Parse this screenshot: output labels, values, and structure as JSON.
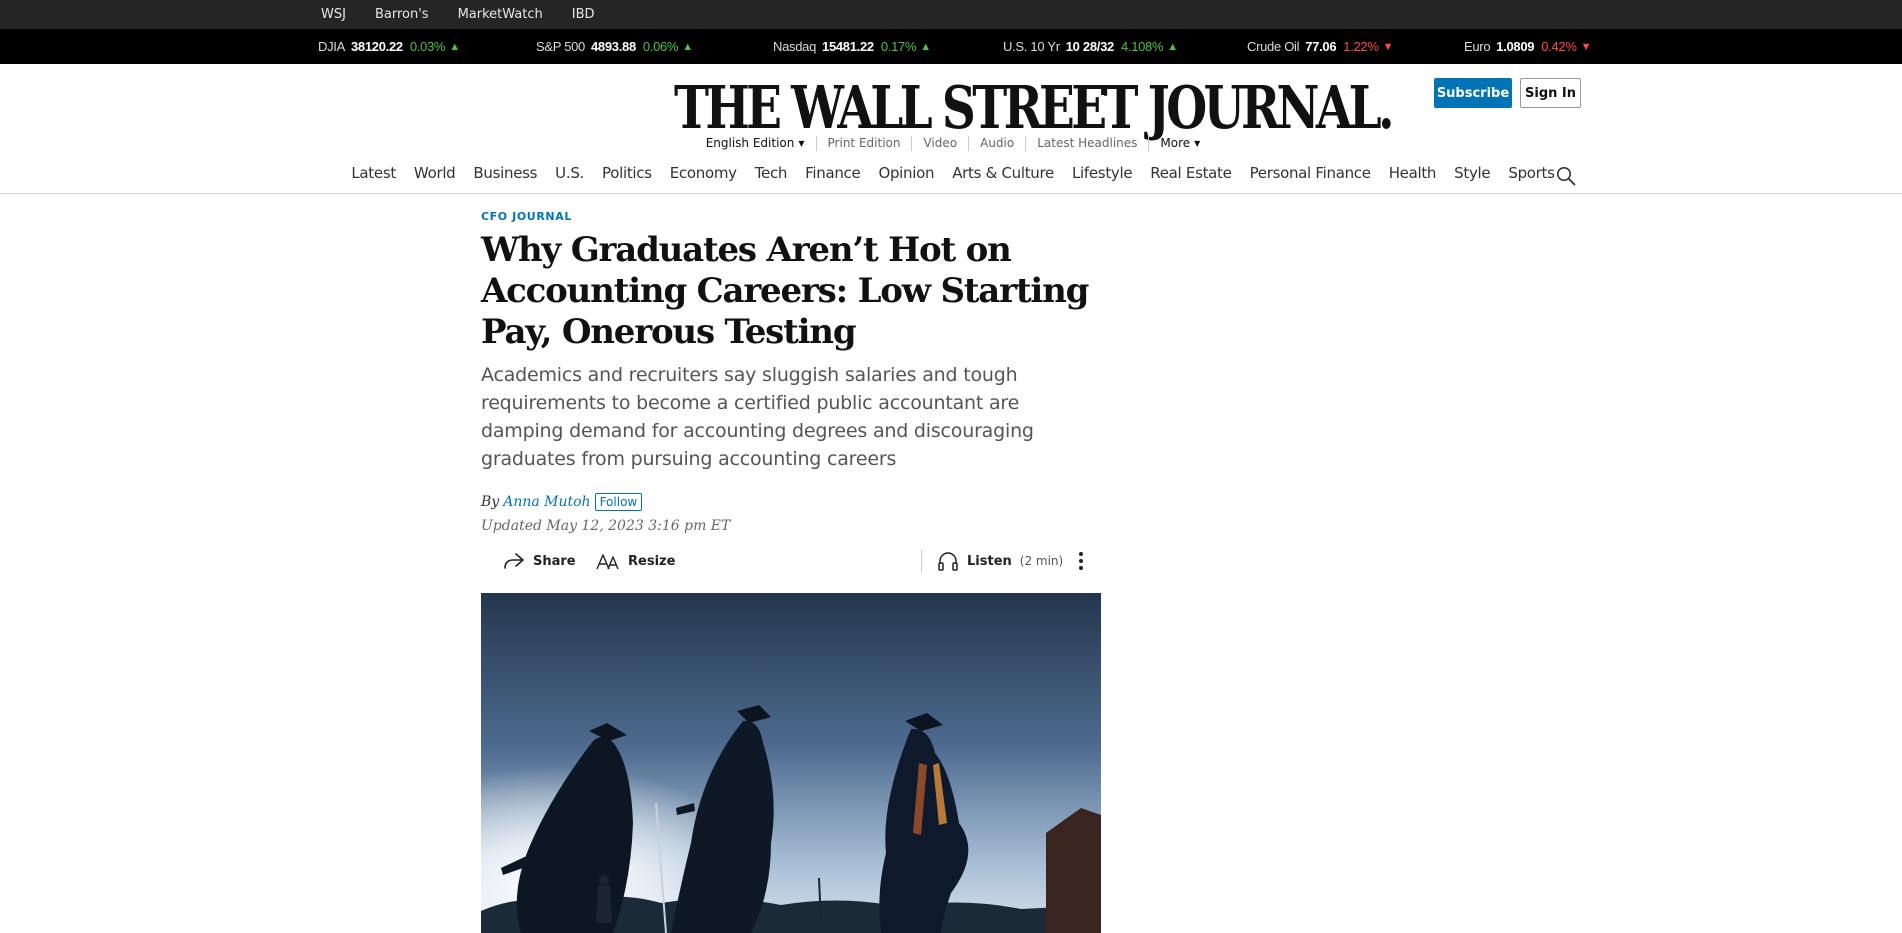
{
  "brand_links": [
    "WSJ",
    "Barron's",
    "MarketWatch",
    "IBD"
  ],
  "ticker": [
    {
      "name": "DJIA",
      "value": "38120.22",
      "change": "0.03%",
      "direction": "up"
    },
    {
      "name": "S&P 500",
      "value": "4893.88",
      "change": "0.06%",
      "direction": "up"
    },
    {
      "name": "Nasdaq",
      "value": "15481.22",
      "change": "0.17%",
      "direction": "up"
    },
    {
      "name": "U.S. 10 Yr",
      "value": "10 28/32",
      "change": "4.108%",
      "direction": "up"
    },
    {
      "name": "Crude Oil",
      "value": "77.06",
      "change": "1.22%",
      "direction": "down"
    },
    {
      "name": "Euro",
      "value": "1.0809",
      "change": "0.42%",
      "direction": "down"
    }
  ],
  "ticker_colors": {
    "up": "#4dc247",
    "down": "#ff4b4b"
  },
  "masthead": {
    "logo": "THE WALL STREET JOURNAL.",
    "subscribe_label": "Subscribe",
    "signin_label": "Sign In"
  },
  "editions": {
    "edition": "English Edition",
    "print": "Print Edition",
    "video": "Video",
    "audio": "Audio",
    "latest_headlines": "Latest Headlines",
    "more": "More"
  },
  "nav": [
    "Latest",
    "World",
    "Business",
    "U.S.",
    "Politics",
    "Economy",
    "Tech",
    "Finance",
    "Opinion",
    "Arts & Culture",
    "Lifestyle",
    "Real Estate",
    "Personal Finance",
    "Health",
    "Style",
    "Sports"
  ],
  "article": {
    "flag": "CFO JOURNAL",
    "headline": "Why Graduates Aren’t Hot on Accounting Careers: Low Starting Pay, Onerous Testing",
    "dek": "Academics and recruiters say sluggish salaries and tough requirements to become a certified public accountant are damping demand for accounting degrees and discouraging graduates from pursuing accounting careers",
    "by": "By",
    "author": "Anna Mutoh",
    "follow_label": "Follow",
    "updated": "Updated May 12, 2023 3:16 pm ET",
    "share_label": "Share",
    "resize_label": "Resize",
    "listen_label": "Listen",
    "listen_duration": "(2 min)"
  },
  "accent_color": "#0274b6"
}
